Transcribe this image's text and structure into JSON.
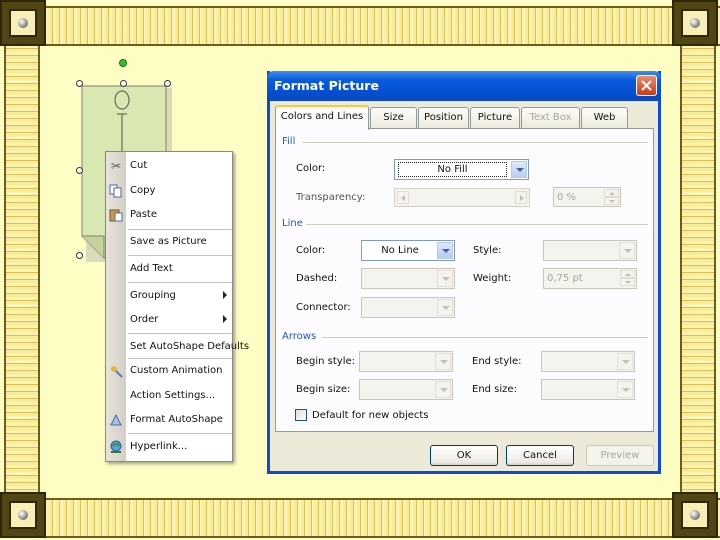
{
  "context_menu": {
    "items": [
      {
        "label": "Cut",
        "icon": "scissors-icon"
      },
      {
        "label": "Copy",
        "icon": "copy-icon"
      },
      {
        "label": "Paste",
        "icon": "paste-icon"
      },
      {
        "label": "Save as Picture",
        "icon": ""
      },
      {
        "label": "Add Text",
        "icon": ""
      },
      {
        "label": "Grouping",
        "icon": "",
        "submenu": true
      },
      {
        "label": "Order",
        "icon": "",
        "submenu": true
      },
      {
        "label": "Set AutoShape Defaults",
        "icon": ""
      },
      {
        "label": "Custom Animation",
        "icon": "animation-icon"
      },
      {
        "label": "Action Settings...",
        "icon": ""
      },
      {
        "label": "Format AutoShape",
        "icon": "format-shape-icon"
      },
      {
        "label": "Hyperlink...",
        "icon": "hyperlink-globe-icon"
      }
    ]
  },
  "dialog": {
    "title": "Format Picture",
    "tabs": [
      "Colors and Lines",
      "Size",
      "Position",
      "Picture",
      "Text Box",
      "Web"
    ],
    "active_tab": "Colors and Lines",
    "fill": {
      "section": "Fill",
      "color_label": "Color:",
      "color_value": "No Fill",
      "transparency_label": "Transparency:",
      "transparency_value": "0 %"
    },
    "line": {
      "section": "Line",
      "color_label": "Color:",
      "color_value": "No Line",
      "style_label": "Style:",
      "dashed_label": "Dashed:",
      "weight_label": "Weight:",
      "weight_value": "0,75 pt",
      "connector_label": "Connector:"
    },
    "arrows": {
      "section": "Arrows",
      "begin_style_label": "Begin style:",
      "end_style_label": "End style:",
      "begin_size_label": "Begin size:",
      "end_size_label": "End size:"
    },
    "default_checkbox_label": "Default for new objects",
    "buttons": {
      "ok": "OK",
      "cancel": "Cancel",
      "preview": "Preview"
    }
  },
  "colors": {
    "slide_background": "#fefdc4",
    "shape_fill": "#d8e8b0",
    "title_bar": "#0a5bdc",
    "section_heading": "#2255d0"
  }
}
